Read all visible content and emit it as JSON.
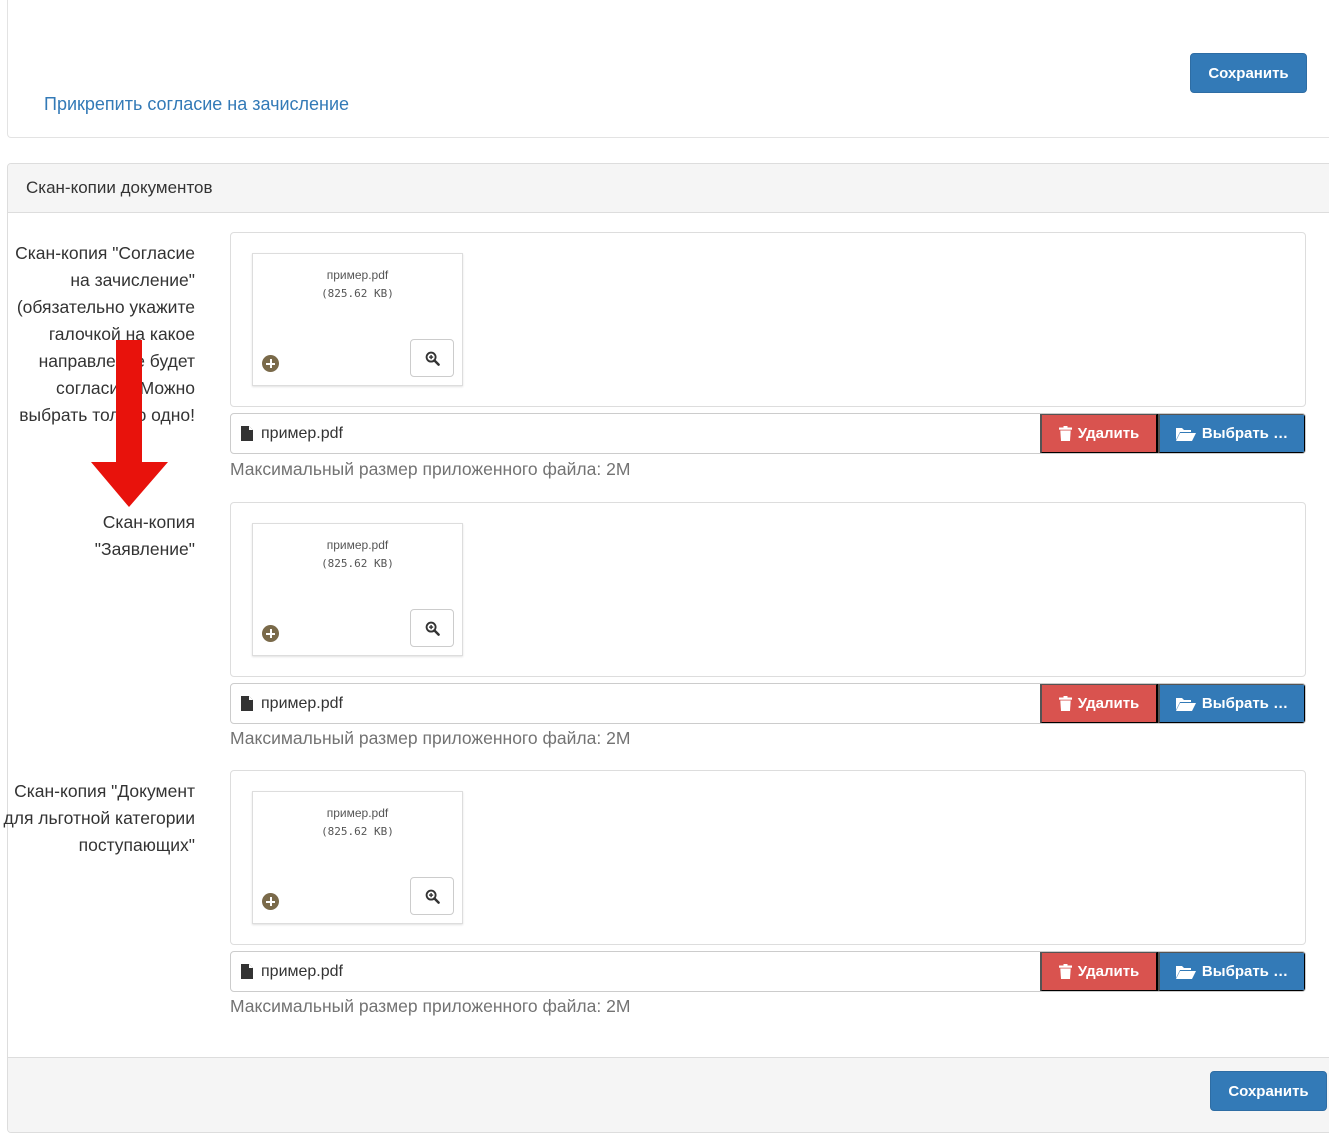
{
  "top": {
    "save_label": "Сохранить",
    "attach_link": "Прикрепить согласие на зачисление"
  },
  "docs": {
    "heading": "Скан-копии документов",
    "save_label": "Сохранить",
    "rows": [
      {
        "label": "Скан-копия \"Согласие на зачисление\" (обязательно укажите галочкой на какое направление будет согласие) Можно выбрать только одно!",
        "thumb_name": "пример.pdf",
        "thumb_size": "(825.62 KB)",
        "caption": "пример.pdf",
        "delete_label": "Удалить",
        "browse_label": "Выбрать …",
        "help": "Максимальный размер приложенного файла: 2M"
      },
      {
        "label": "Скан-копия \"Заявление\"",
        "thumb_name": "пример.pdf",
        "thumb_size": "(825.62 KB)",
        "caption": "пример.pdf",
        "delete_label": "Удалить",
        "browse_label": "Выбрать …",
        "help": "Максимальный размер приложенного файла: 2M"
      },
      {
        "label": "Скан-копия \"Документ для льготной категории поступающих\"",
        "thumb_name": "пример.pdf",
        "thumb_size": "(825.62 KB)",
        "caption": "пример.pdf",
        "delete_label": "Удалить",
        "browse_label": "Выбрать …",
        "help": "Максимальный размер приложенного файла: 2M"
      }
    ]
  },
  "colors": {
    "primary": "#337ab7",
    "danger": "#d9534f",
    "annotation_arrow": "#e8120c"
  },
  "icons": {
    "zoom": "zoom-in-icon",
    "plus": "plus-circle-icon",
    "file": "file-icon",
    "trash": "trash-icon",
    "folder": "folder-open-icon",
    "arrow": "down-arrow-icon"
  }
}
